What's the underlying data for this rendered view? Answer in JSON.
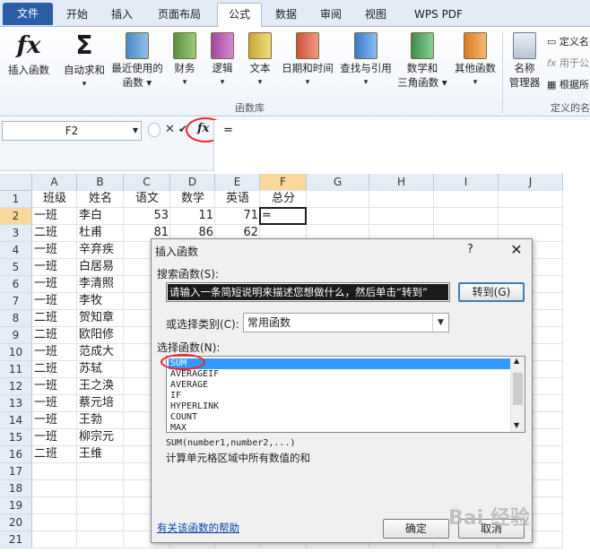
{
  "tabs": [
    {
      "label": "文件"
    },
    {
      "label": "开始"
    },
    {
      "label": "插入"
    },
    {
      "label": "页面布局"
    },
    {
      "label": "公式"
    },
    {
      "label": "数据"
    },
    {
      "label": "审阅"
    },
    {
      "label": "视图"
    },
    {
      "label": "WPS PDF"
    }
  ],
  "ribbon": {
    "buttons": [
      {
        "line1": "插入函数",
        "line2": ""
      },
      {
        "line1": "自动求和",
        "line2": "▾"
      },
      {
        "line1": "最近使用的",
        "line2": "函数 ▾"
      },
      {
        "line1": "财务",
        "line2": "▾"
      },
      {
        "line1": "逻辑",
        "line2": "▾"
      },
      {
        "line1": "文本",
        "line2": "▾"
      },
      {
        "line1": "日期和时间",
        "line2": "▾"
      },
      {
        "line1": "查找与引用",
        "line2": "▾"
      },
      {
        "line1": "数学和",
        "line2": "三角函数 ▾"
      },
      {
        "line1": "其他函数",
        "line2": "▾"
      },
      {
        "line1": "名称",
        "line2": "管理器"
      }
    ],
    "group_label": "函数库",
    "group_label_right": "定义的名",
    "right_items": [
      "定义名",
      "用于公",
      "根据所"
    ]
  },
  "formula_bar": {
    "name_box": "F2",
    "cancel": "✕",
    "confirm": "✔",
    "fx": "fx",
    "formula": "="
  },
  "sheet": {
    "columns": [
      "A",
      "B",
      "C",
      "D",
      "E",
      "F",
      "G",
      "H",
      "I",
      "J"
    ],
    "rows": [
      "1",
      "2",
      "3",
      "4",
      "5",
      "6",
      "7",
      "8",
      "9",
      "10",
      "11",
      "12",
      "13",
      "14",
      "15",
      "16",
      "17",
      "18",
      "19",
      "20",
      "21"
    ],
    "header_row": [
      "班级",
      "姓名",
      "语文",
      "数学",
      "英语",
      "总分"
    ],
    "data": [
      {
        "a": "一班",
        "b": "李白",
        "c": "53",
        "d": "11",
        "e": "71",
        "f": "="
      },
      {
        "a": "二班",
        "b": "杜甫",
        "c": "81",
        "d": "86",
        "e": "62",
        "f": ""
      },
      {
        "a": "一班",
        "b": "辛弃疾",
        "c": "",
        "d": "",
        "e": "",
        "f": ""
      },
      {
        "a": "一班",
        "b": "白居易",
        "c": "",
        "d": "",
        "e": "",
        "f": ""
      },
      {
        "a": "一班",
        "b": "李清照",
        "c": "",
        "d": "",
        "e": "",
        "f": ""
      },
      {
        "a": "一班",
        "b": "李牧",
        "c": "",
        "d": "",
        "e": "",
        "f": ""
      },
      {
        "a": "二班",
        "b": "贺知章",
        "c": "",
        "d": "",
        "e": "",
        "f": ""
      },
      {
        "a": "二班",
        "b": "欧阳修",
        "c": "",
        "d": "",
        "e": "",
        "f": ""
      },
      {
        "a": "一班",
        "b": "范成大",
        "c": "",
        "d": "",
        "e": "",
        "f": ""
      },
      {
        "a": "二班",
        "b": "苏轼",
        "c": "",
        "d": "",
        "e": "",
        "f": ""
      },
      {
        "a": "一班",
        "b": "王之涣",
        "c": "",
        "d": "",
        "e": "",
        "f": ""
      },
      {
        "a": "一班",
        "b": "蔡元培",
        "c": "",
        "d": "",
        "e": "",
        "f": ""
      },
      {
        "a": "一班",
        "b": "王勃",
        "c": "",
        "d": "",
        "e": "",
        "f": ""
      },
      {
        "a": "一班",
        "b": "柳宗元",
        "c": "",
        "d": "",
        "e": "",
        "f": ""
      },
      {
        "a": "二班",
        "b": "王维",
        "c": "",
        "d": "",
        "e": "",
        "f": ""
      }
    ]
  },
  "dialog": {
    "title": "插入函数",
    "help": "?",
    "close": "✕",
    "search_label": "搜索函数(S):",
    "search_value": "请输入一条简短说明来描述您想做什么，然后单击“转到”",
    "go_button": "转到(G)",
    "category_label": "或选择类别(C):",
    "category_value": "常用函数",
    "select_label": "选择函数(N):",
    "functions": [
      "SUM",
      "AVERAGEIF",
      "AVERAGE",
      "IF",
      "HYPERLINK",
      "COUNT",
      "MAX"
    ],
    "syntax": "SUM(number1,number2,...)",
    "description": "计算单元格区域中所有数值的和",
    "help_link": "有关该函数的帮助",
    "ok": "确定",
    "cancel": "取消"
  },
  "watermark": "Bai 经验"
}
